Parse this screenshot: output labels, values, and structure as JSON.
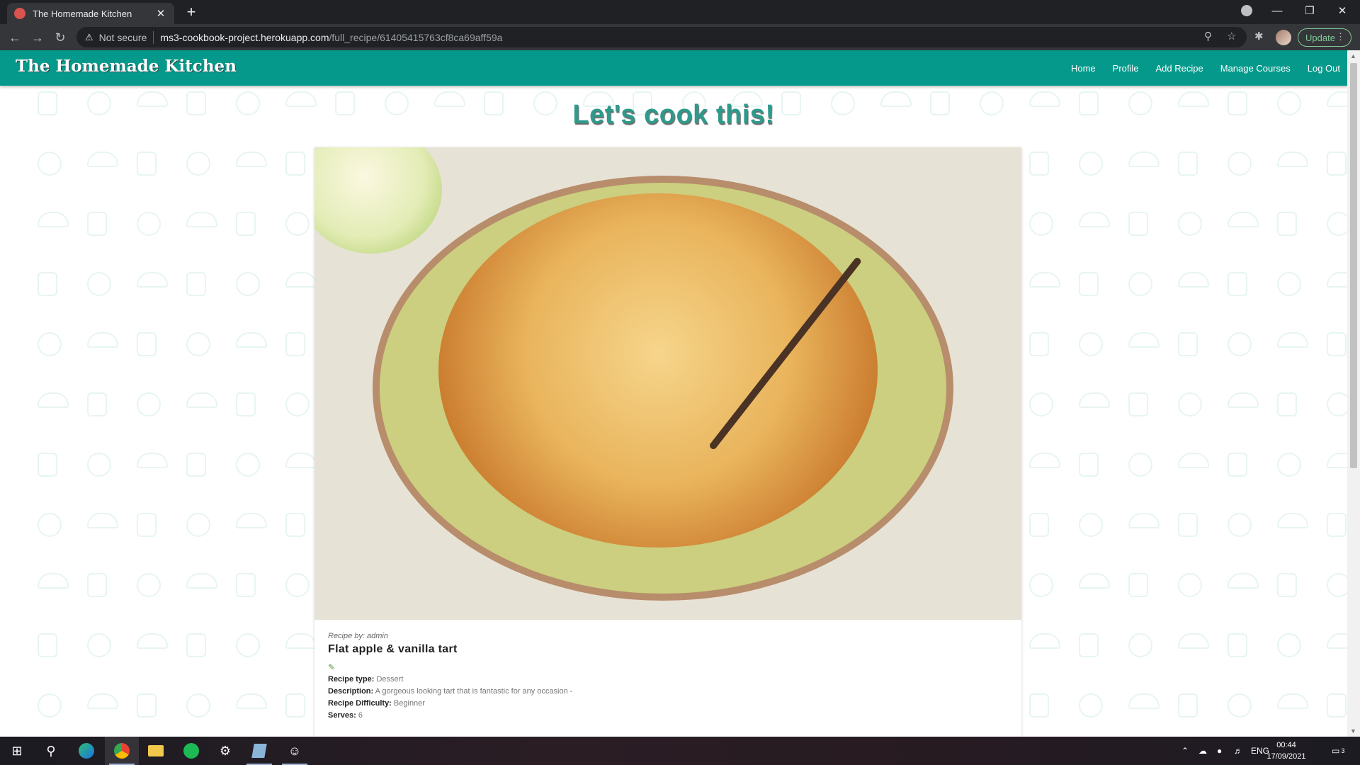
{
  "browser": {
    "tab_title": "The Homemade Kitchen",
    "new_tab_label": "+",
    "close_tab_label": "✕",
    "url_warning": "Not secure",
    "url_host": "ms3-cookbook-project.herokuapp.com",
    "url_path": "/full_recipe/61405415763cf8ca69aff59a",
    "update_label": "Update"
  },
  "site": {
    "brand": "The Homemade Kitchen",
    "nav": [
      "Home",
      "Profile",
      "Add Recipe",
      "Manage Courses",
      "Log Out"
    ],
    "accent_color": "#05998b",
    "heading_color": "#2e9a8c"
  },
  "page": {
    "heading": "Let's cook this!"
  },
  "recipe": {
    "byline": "Recipe by: admin",
    "title": "Flat apple & vanilla tart",
    "image_subject": "apple tart on a green plate with vanilla pod and halved apple",
    "details": [
      {
        "label": "Recipe type:",
        "value": "Dessert"
      },
      {
        "label": "Description:",
        "value": "A gorgeous looking tart that is fantastic for any occasion -"
      },
      {
        "label": "Recipe Difficulty:",
        "value": "Beginner"
      },
      {
        "label": "Serves:",
        "value": "6"
      }
    ]
  },
  "taskbar": {
    "language": "ENG",
    "time": "00:44",
    "date": "17/09/2021",
    "notification_count": "3",
    "apps": [
      "start-icon",
      "search-icon",
      "edge-icon",
      "chrome-icon",
      "file-explorer-icon",
      "spotify-icon",
      "app-icon",
      "app-icon",
      "app-icon"
    ]
  }
}
